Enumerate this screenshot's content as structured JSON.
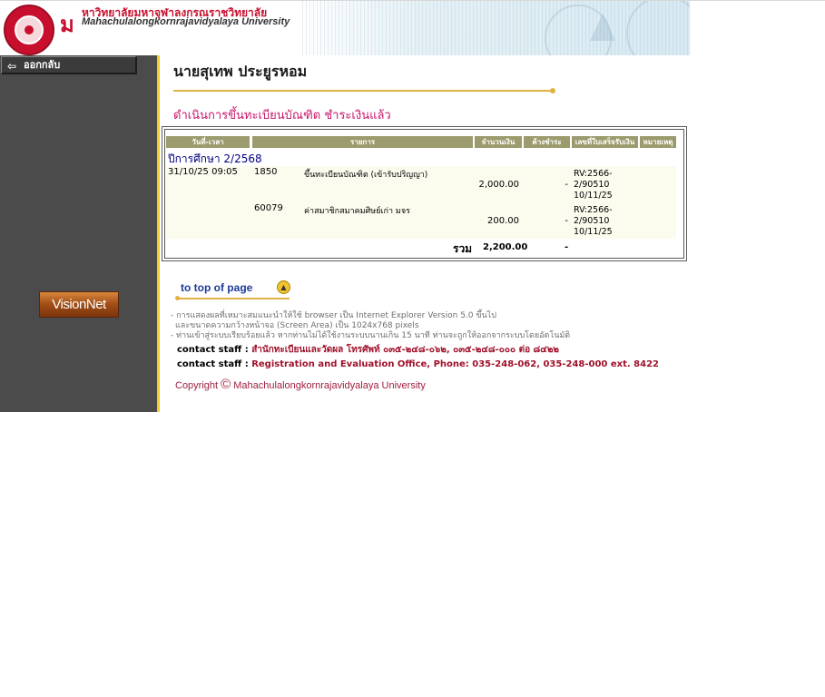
{
  "header": {
    "logo_mark": "ม",
    "university_thai": "หาวิทยาลัยมหาจุฬาลงกรณราชวิทยาลัย",
    "university_en": "Mahachulalongkornrajavidyalaya University"
  },
  "sidebar": {
    "back_label": "ออกกลับ",
    "visionnet_label": "VisionNet"
  },
  "main": {
    "student_name": "นายสุเทพ ประยูรหอม",
    "status_text": "ดำเนินการขึ้นทะเบียนบัณฑิต ชำระเงินแล้ว"
  },
  "table": {
    "headers": [
      "วันที่-เวลา",
      "รายการ",
      "จำนวนเงิน",
      "ค้างชำระ",
      "เลขที่ใบเสร็จรับเงิน",
      "หมายเหตุ"
    ],
    "term_label": "ปีการศึกษา 2/2568",
    "rows": [
      {
        "datetime": "31/10/25 09:05",
        "code": "1850",
        "description": "ขึ้นทะเบียนบัณฑิต (เข้ารับปริญญา)",
        "amount": "2,000.00",
        "outstanding": "-",
        "receipt_line1": "RV:2566-",
        "receipt_line2": "2/90510",
        "receipt_line3": "10/11/25"
      },
      {
        "datetime": "",
        "code": "60079",
        "description": "ค่าสมาชิกสมาคมศิษย์เก่า มจร",
        "amount": "200.00",
        "outstanding": "-",
        "receipt_line1": "RV:2566-",
        "receipt_line2": "2/90510",
        "receipt_line3": "10/11/25"
      }
    ],
    "total_label": "รวม",
    "total_amount": "2,200.00",
    "total_outstanding": "-"
  },
  "footer": {
    "to_top_label": "to top of page",
    "note_line1": "- การแสดงผลที่เหมาะสมแนะนำให้ใช้ browser เป็น Internet Explorer Version 5.0 ขึ้นไป",
    "note_line2": "และขนาดความกว้างหน้าจอ (Screen Area) เป็น 1024x768 pixels",
    "note_line3": "- ท่านเข้าสู่ระบบเรียบร้อยแล้ว หากท่านไม่ได้ใช้งานระบบนานเกิน 15 นาที ท่านจะถูกให้ออกจากระบบโดยอัตโนมัติ",
    "contact_label": "contact staff :",
    "contact_thai": "สำนักทะเบียนและวัดผล โทรศัพท์ ๐๓๕-๒๔๘-๐๖๒, ๐๓๕-๒๔๘-๐๐๐ ต่อ ๘๔๒๒",
    "contact_en": "Registration and Evaluation Office, Phone: 035-248-062, 035-248-000 ext. 8422",
    "copyright_prefix": "Copyright",
    "copyright_symbol": "©",
    "copyright_holder": "Mahachulalongkornrajavidyalaya University"
  },
  "colors": {
    "sidebar_bg": "#4b4b4b",
    "accent_gold": "#e2b243",
    "status_pink": "#c8186c",
    "table_header": "#9c9b6e",
    "contact_red": "#a0102a"
  },
  "icons": {
    "back": "arrow-left-icon",
    "to_top": "arrow-up-circle-icon",
    "seal": "university-seal-icon"
  }
}
